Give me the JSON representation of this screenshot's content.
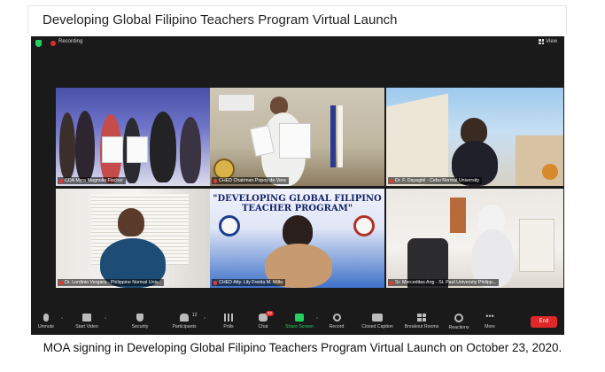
{
  "header": {
    "title": "Developing Global Filipino Teachers Program Virtual Launch"
  },
  "meeting": {
    "recording_label": "Recording",
    "view_label": "View",
    "accent_green": "#23d160",
    "end_red": "#e02828"
  },
  "participants": [
    {
      "name": "CDA Myra Magnolia Fischer"
    },
    {
      "name": "CHED Chairman Popoy de Vera"
    },
    {
      "name": "Dr. F. Dayagbil - Cebu Normal University"
    },
    {
      "name": "Dr. Lordinio Vergara - Philippine Normal Univ..."
    },
    {
      "name": "CHED Atty. Lily Freida M. Milla"
    },
    {
      "name": "Sr. Merceditas Ang - St. Paul University Philipp..."
    }
  ],
  "tile_banner": {
    "text": "\"DEVELOPING GLOBAL FILIPINO TEACHER PROGRAM\""
  },
  "toolbar": {
    "unmute": "Unmute",
    "start_video": "Start Video",
    "security": "Security",
    "participants": "Participants",
    "participants_count": "12",
    "polls": "Polls",
    "chat": "Chat",
    "chat_badge": "52",
    "share_screen": "Share Screen",
    "record": "Record",
    "closed_caption": "Closed Caption",
    "breakout_rooms": "Breakout Rooms",
    "reactions": "Reactions",
    "more": "More",
    "end": "End"
  },
  "caption": "MOA signing in Developing Global Filipino Teachers Program Virtual Launch on October 23, 2020."
}
